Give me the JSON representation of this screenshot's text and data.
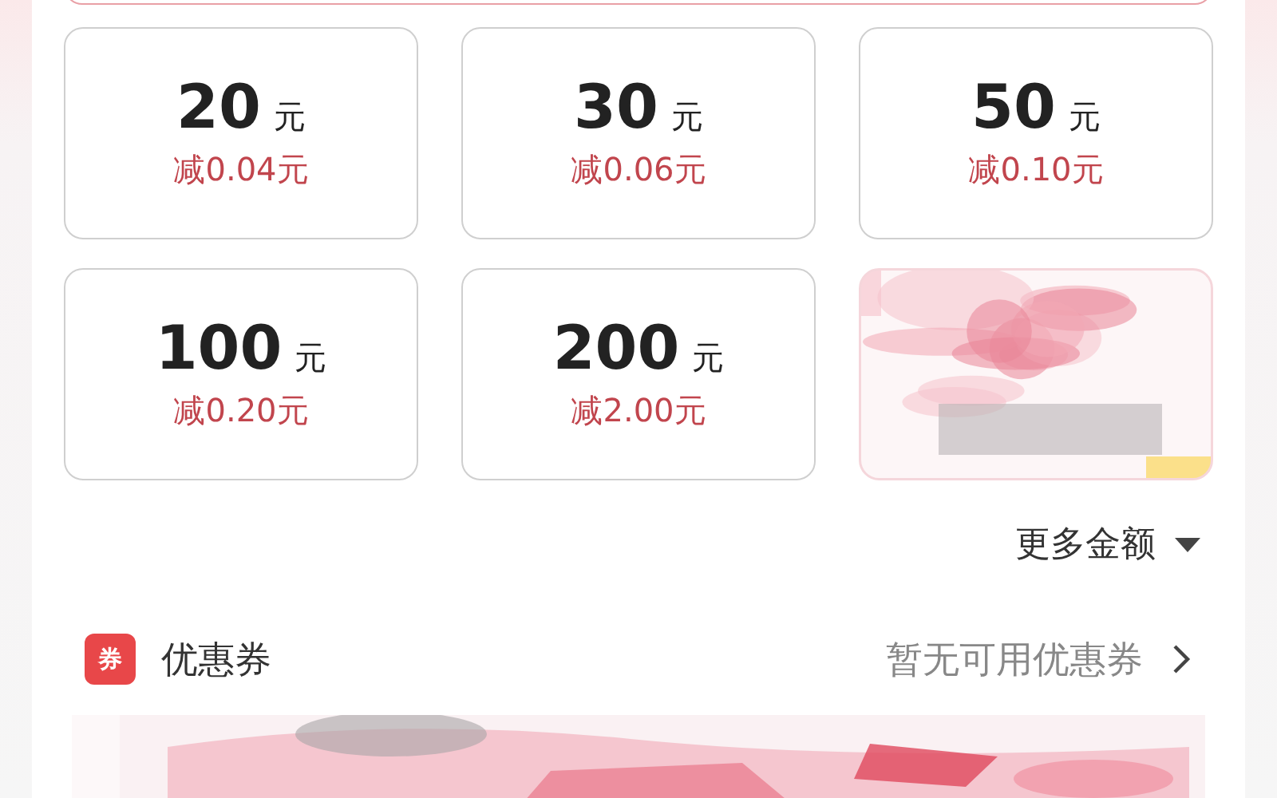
{
  "amounts": [
    {
      "kind": "amount",
      "value": "20",
      "unit": "元",
      "discount": "减0.04元"
    },
    {
      "kind": "amount",
      "value": "30",
      "unit": "元",
      "discount": "减0.06元"
    },
    {
      "kind": "amount",
      "value": "50",
      "unit": "元",
      "discount": "减0.10元"
    },
    {
      "kind": "amount",
      "value": "100",
      "unit": "元",
      "discount": "减0.20元"
    },
    {
      "kind": "amount",
      "value": "200",
      "unit": "元",
      "discount": "减2.00元"
    },
    {
      "kind": "picture"
    }
  ],
  "more_amounts": {
    "label": "更多金额",
    "expanded": false
  },
  "coupon": {
    "badge": "券",
    "title": "优惠券",
    "status": "暂无可用优惠券"
  },
  "banner": {
    "kind": "picture"
  }
}
